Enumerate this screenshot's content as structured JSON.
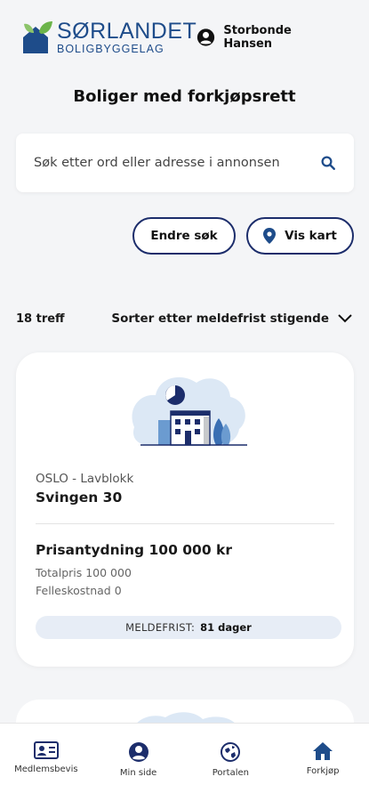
{
  "header": {
    "logo_main": "SØRLANDET",
    "logo_sub": "BOLIGBYGGELAG",
    "user_name": "Storbonde Hansen",
    "icons": {
      "user": "account-circle-icon",
      "logo": "house-leaf-logo"
    }
  },
  "page": {
    "title": "Boliger med forkjøpsrett"
  },
  "search": {
    "placeholder": "Søk etter ord eller adresse i annonsen",
    "icon": "search-icon"
  },
  "actions": {
    "change_search": "Endre søk",
    "show_map": "Vis kart",
    "map_icon": "location-pin-icon"
  },
  "results": {
    "count": "18 treff",
    "sort_label": "Sorter etter meldefrist stigende",
    "sort_icon": "chevron-down-icon"
  },
  "listing": {
    "location": "OSLO - Lavblokk",
    "street": "Svingen 30",
    "price": "Prisantydning 100 000 kr",
    "total": "Totalpris 100 000",
    "common_cost": "Felleskostnad 0",
    "deadline_label": "MELDEFRIST:",
    "deadline_value": "81 dager"
  },
  "tabbar": {
    "items": [
      {
        "label": "Medlemsbevis",
        "icon": "id-card-icon"
      },
      {
        "label": "Min side",
        "icon": "account-circle-icon"
      },
      {
        "label": "Portalen",
        "icon": "portal-globe-icon"
      },
      {
        "label": "Forkjøp",
        "icon": "home-icon",
        "active": true
      }
    ]
  },
  "colors": {
    "brand": "#1e4c8a",
    "leaf": "#6cb44a",
    "outline": "#1c2d6b",
    "background": "#f4f5f7",
    "active_tab": "#1e4c8a"
  }
}
